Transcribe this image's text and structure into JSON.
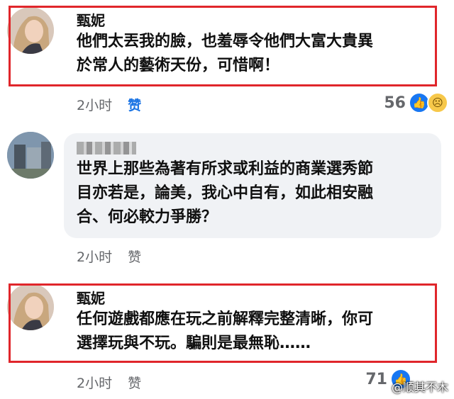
{
  "comments": [
    {
      "author": "甄妮",
      "text": "他們太丟我的臉，也羞辱令他們大富大貴異\n於常人的藝術天份，可惜啊！",
      "time": "2小时",
      "like": "赞",
      "reaction_count": "56"
    },
    {
      "author": "",
      "text": "世界上那些為著有所求或利益的商業選秀節\n目亦若是，論美，我心中自有，如此相安融\n合、何必較力爭勝？",
      "time": "2小时",
      "like": "赞"
    },
    {
      "author": "甄妮",
      "text": "任何遊戲都應在玩之前解釋完整清晰，你可\n選擇玩與不玩。騙則是最無恥……",
      "time": "2小时",
      "like": "赞",
      "reaction_count": "71"
    }
  ],
  "watermark": "@顺其不木",
  "colors": {
    "highlight": "#e0262b",
    "like_blue": "#1b74e4",
    "bubble": "#f0f2f5"
  },
  "icons": [
    "like-reaction-icon",
    "sad-reaction-icon"
  ]
}
